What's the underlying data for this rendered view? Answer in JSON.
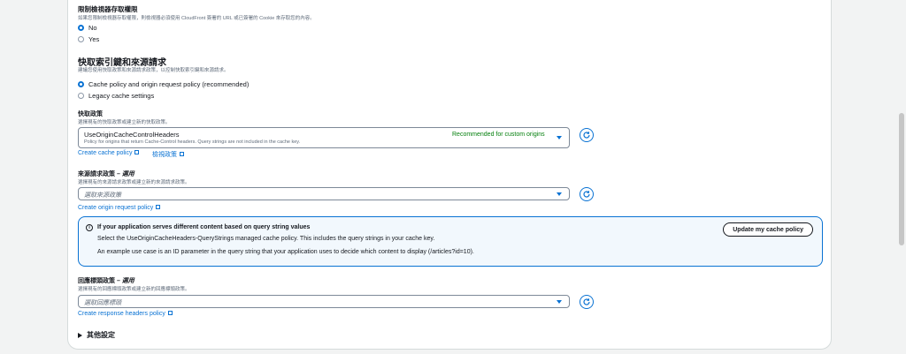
{
  "viewer_access": {
    "title": "限制檢視器存取權限",
    "description": "如果您限制檢視器存取權限，則檢視器必須使用 CloudFront 簽署的 URL 或已簽署的 Cookie 來存取您的內容。",
    "options": [
      "No",
      "Yes"
    ],
    "selected": "No"
  },
  "cache_key": {
    "title": "快取索引鍵和來源請求",
    "description": "建議您使用快取政策和來源請求政策，以控制快取索引鍵和來源請求。",
    "options": [
      "Cache policy and origin request policy (recommended)",
      "Legacy cache settings"
    ],
    "selected": "Cache policy and origin request policy (recommended)"
  },
  "cache_policy": {
    "label": "快取政策",
    "description": "選擇現有的快取政策或建立新的快取政策。",
    "selected_value": "UseOriginCacheControlHeaders",
    "selected_detail": "Policy for origins that return Cache-Control headers. Query strings are not included in the cache key.",
    "badge": "Recommended for custom origins",
    "create_link": "Create cache policy",
    "view_link": "檢視政策"
  },
  "origin_request_policy": {
    "label": "來源請求政策 – ",
    "label_optional": "選用",
    "description": "選擇現有的來源請求政策或建立新的來源請求政策。",
    "placeholder": "選取來源政策",
    "create_link": "Create origin request policy"
  },
  "info_alert": {
    "title": "If your application serves different content based on query string values",
    "line1": "Select the UseOriginCacheHeaders-QueryStrings managed cache policy. This includes the query strings in your cache key.",
    "line2": "An example use case is an ID parameter in the query string that your application uses to decide which content to display (/articles?id=10).",
    "button": "Update my cache policy"
  },
  "response_headers_policy": {
    "label": "回應標頭政策 – ",
    "label_optional": "選用",
    "description": "選擇現有的回應標頭政策或建立新的回應標頭政策。",
    "placeholder": "選取回應標頭",
    "create_link": "Create response headers policy"
  },
  "other_settings": {
    "label": "其他設定"
  },
  "colors": {
    "accent": "#0972d3",
    "success": "#037f0c",
    "info_bg": "#f2f8fd"
  }
}
